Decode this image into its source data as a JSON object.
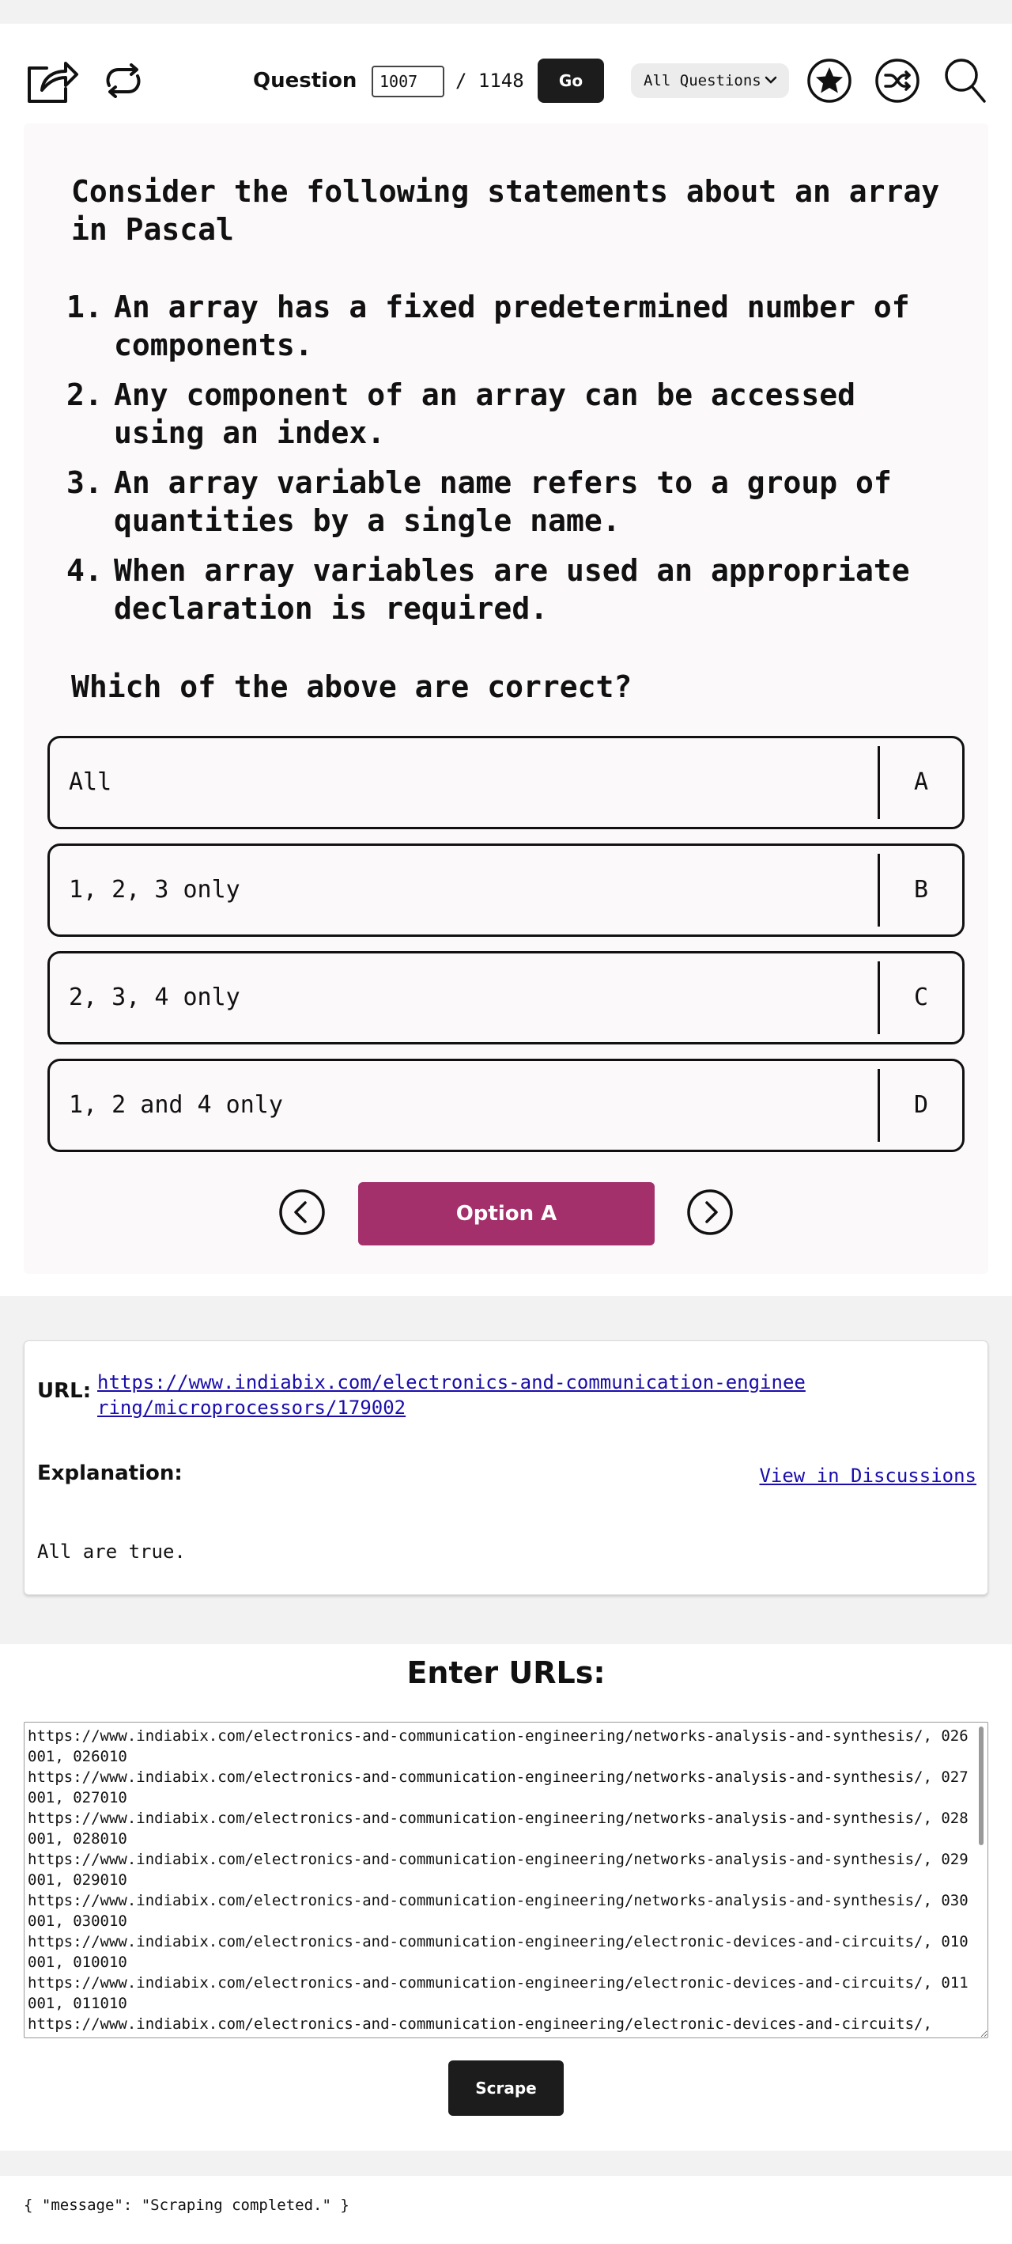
{
  "toolbar": {
    "question_label": "Question",
    "question_number": "1007",
    "question_total": "/ 1148",
    "go_label": "Go",
    "filter_value": "All Questions",
    "icons": [
      "share-icon",
      "refresh-icon",
      "star-icon",
      "shuffle-icon",
      "search-icon"
    ]
  },
  "question": {
    "intro": "Consider the following statements about an array in Pascal",
    "statements": [
      {
        "num": "1.",
        "text": "An array has a fixed predetermined number of components."
      },
      {
        "num": "2.",
        "text": "Any component of an array can be accessed using an index."
      },
      {
        "num": "3.",
        "text": "An array variable name refers to a group of quantities by a single name."
      },
      {
        "num": "4.",
        "text": "When array variables are used an appropriate declaration is required."
      }
    ],
    "ask": "Which of the above are correct?"
  },
  "options": [
    {
      "text": "All",
      "letter": "A"
    },
    {
      "text": "1, 2, 3 only",
      "letter": "B"
    },
    {
      "text": "2, 3, 4 only",
      "letter": "C"
    },
    {
      "text": "1, 2 and 4 only",
      "letter": "D"
    }
  ],
  "answer_label": "Option A",
  "info": {
    "url_label": "URL:",
    "url": "https://www.indiabix.com/electronics-and-communication-engineering/microprocessors/179002",
    "explanation_label": "Explanation:",
    "discussions_link": "View in Discussions",
    "explanation": "All are true."
  },
  "scraper": {
    "title": "Enter URLs:",
    "urls_text": "https://www.indiabix.com/electronics-and-communication-engineering/networks-analysis-and-synthesis/, 026001, 026010\nhttps://www.indiabix.com/electronics-and-communication-engineering/networks-analysis-and-synthesis/, 027001, 027010\nhttps://www.indiabix.com/electronics-and-communication-engineering/networks-analysis-and-synthesis/, 028001, 028010\nhttps://www.indiabix.com/electronics-and-communication-engineering/networks-analysis-and-synthesis/, 029001, 029010\nhttps://www.indiabix.com/electronics-and-communication-engineering/networks-analysis-and-synthesis/, 030001, 030010\nhttps://www.indiabix.com/electronics-and-communication-engineering/electronic-devices-and-circuits/, 010001, 010010\nhttps://www.indiabix.com/electronics-and-communication-engineering/electronic-devices-and-circuits/, 011001, 011010\nhttps://www.indiabix.com/electronics-and-communication-engineering/electronic-devices-and-circuits/,",
    "scrape_label": "Scrape",
    "result": "{ \"message\": \"Scraping completed.\" }"
  }
}
